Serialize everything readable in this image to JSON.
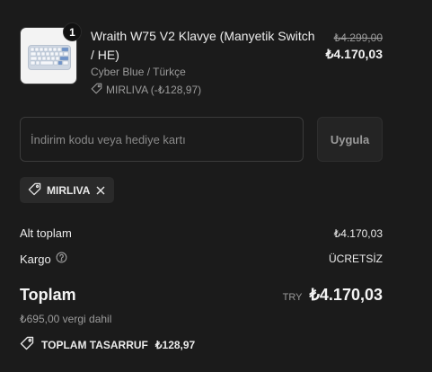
{
  "product": {
    "name": "Wraith W75 V2 Klavye (Manyetik Switch / HE)",
    "variant": "Cyber Blue / Türkçe",
    "quantity": "1",
    "discount_line": "MIRLIVA (-₺128,97)",
    "original_price": "₺4.299,00",
    "price": "₺4.170,03",
    "thumbnail_icon": "keyboard-icon"
  },
  "discount": {
    "placeholder": "İndirim kodu veya hediye kartı",
    "apply_label": "Uygula",
    "applied_code": "MIRLIVA"
  },
  "summary": {
    "subtotal_label": "Alt toplam",
    "subtotal_value": "₺4.170,03",
    "shipping_label": "Kargo",
    "shipping_value": "ÜCRETSİZ",
    "total_label": "Toplam",
    "currency": "TRY",
    "total_value": "₺4.170,03",
    "tax_note": "₺695,00 vergi dahil",
    "savings_label": "TOPLAM TASARRUF",
    "savings_value": "₺128,97"
  },
  "colors": {
    "background": "#1b1b1b",
    "text": "#e9e9e9",
    "muted": "#9b9b9b",
    "border": "#3b3b3b"
  }
}
